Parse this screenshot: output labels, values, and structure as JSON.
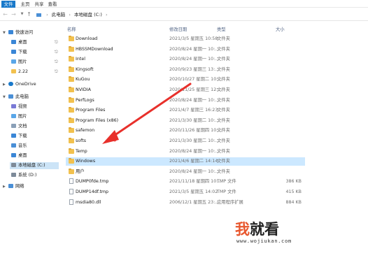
{
  "ribbon": {
    "tabs": [
      "文件",
      "主页",
      "共享",
      "查看"
    ]
  },
  "address": {
    "segments": [
      "此电脑",
      "本地磁盘 (C:)"
    ]
  },
  "sidebar": {
    "quick_access": "快速访问",
    "quick_items": [
      "桌面",
      "下载",
      "图片",
      "2.22"
    ],
    "onedrive": "OneDrive",
    "this_pc": "此电脑",
    "pc_items": [
      "视频",
      "图片",
      "文档",
      "下载",
      "音乐",
      "桌面",
      "本地磁盘 (C:)",
      "系统 (D:)"
    ],
    "network": "网络"
  },
  "columns": {
    "name": "名称",
    "date": "修改日期",
    "type": "类型",
    "size": "大小"
  },
  "files": [
    {
      "name": "Download",
      "date": "2021/3/5 星期五 10:58",
      "type": "文件夹",
      "size": "",
      "kind": "folder"
    },
    {
      "name": "HBSSMDownload",
      "date": "2020/8/24 星期一 10:...",
      "type": "文件夹",
      "size": "",
      "kind": "folder"
    },
    {
      "name": "Intel",
      "date": "2020/8/24 星期一 10:...",
      "type": "文件夹",
      "size": "",
      "kind": "folder"
    },
    {
      "name": "Kingsoft",
      "date": "2020/9/23 星期三 13:...",
      "type": "文件夹",
      "size": "",
      "kind": "folder"
    },
    {
      "name": "KuGou",
      "date": "2020/10/27 星期二 10:...",
      "type": "文件夹",
      "size": "",
      "kind": "folder"
    },
    {
      "name": "NVIDIA",
      "date": "2020/11/25 星期三 12:...",
      "type": "文件夹",
      "size": "",
      "kind": "folder"
    },
    {
      "name": "PerfLogs",
      "date": "2020/8/24 星期一 10:...",
      "type": "文件夹",
      "size": "",
      "kind": "folder"
    },
    {
      "name": "Program Files",
      "date": "2021/4/7 星期三 16:23",
      "type": "文件夹",
      "size": "",
      "kind": "folder"
    },
    {
      "name": "Program Files (x86)",
      "date": "2021/3/30 星期二 10:...",
      "type": "文件夹",
      "size": "",
      "kind": "folder"
    },
    {
      "name": "safemon",
      "date": "2020/11/26 星期四 10:...",
      "type": "文件夹",
      "size": "",
      "kind": "folder"
    },
    {
      "name": "softs",
      "date": "2021/3/30 星期二 10:...",
      "type": "文件夹",
      "size": "",
      "kind": "folder"
    },
    {
      "name": "Temp",
      "date": "2020/8/24 星期一 10:...",
      "type": "文件夹",
      "size": "",
      "kind": "folder"
    },
    {
      "name": "Windows",
      "date": "2021/4/6 星期二 14:14",
      "type": "文件夹",
      "size": "",
      "kind": "folder",
      "selected": true
    },
    {
      "name": "用户",
      "date": "2020/8/24 星期一 10:...",
      "type": "文件夹",
      "size": "",
      "kind": "folder"
    },
    {
      "name": "DUMP0fde.tmp",
      "date": "2021/11/18 星期四 10:...",
      "type": "TMP 文件",
      "size": "386 KB",
      "kind": "file"
    },
    {
      "name": "DUMP14df.tmp",
      "date": "2021/3/5 星期五 14:02",
      "type": "TMP 文件",
      "size": "415 KB",
      "kind": "file"
    },
    {
      "name": "msdia80.dll",
      "date": "2006/12/1 星期五 23:...",
      "type": "应用程序扩展",
      "size": "884 KB",
      "kind": "file"
    }
  ],
  "watermark": {
    "logo_part1": "我",
    "logo_part2": "就看",
    "url": "www.wojiukan.com"
  },
  "colors": {
    "ribbon_active": "#1979ca",
    "selection": "#cce8ff",
    "arrow": "#e8302b",
    "folder": "#f2c14e"
  }
}
